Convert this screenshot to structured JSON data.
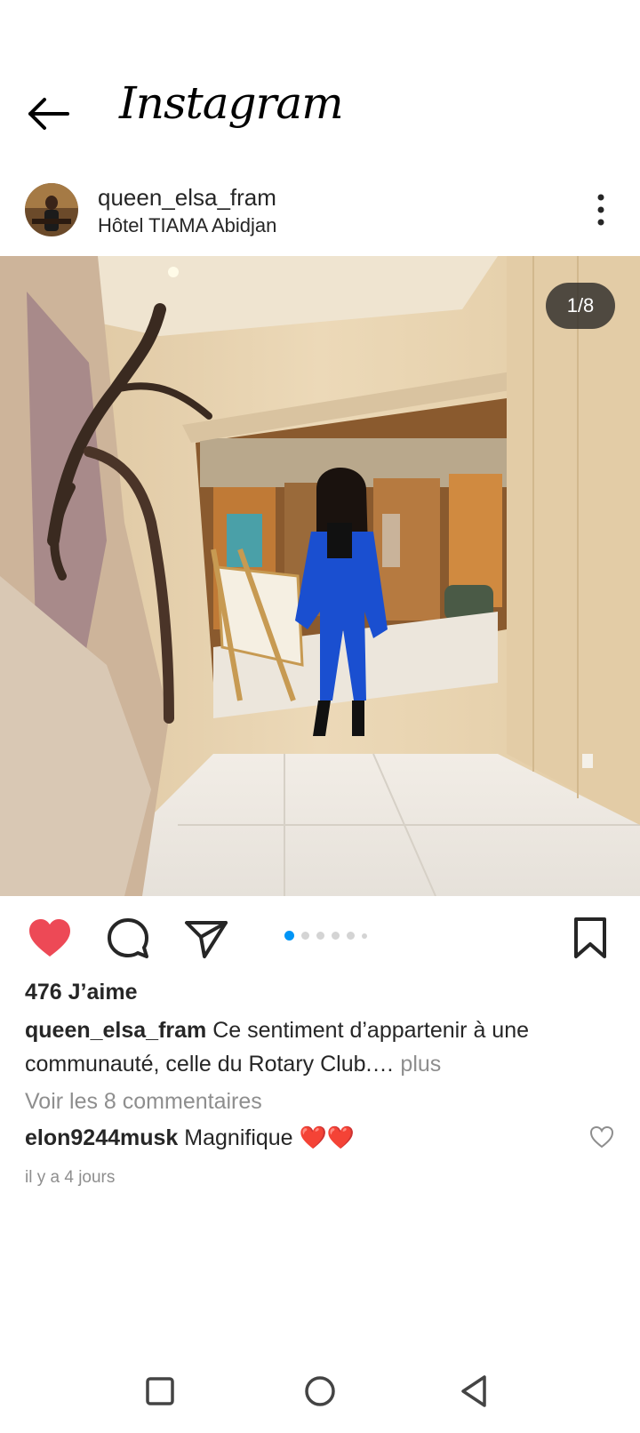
{
  "app": {
    "title": "Instagram"
  },
  "post": {
    "username": "queen_elsa_fram",
    "location": "Hôtel TIAMA Abidjan",
    "media_counter": "1/8",
    "carousel": {
      "total_dots": 6,
      "active_index": 0
    },
    "liked": true,
    "likes_text": "476 J’aime",
    "caption": {
      "username": "queen_elsa_fram",
      "text": "Ce sentiment d’appartenir à une communauté, celle du Rotary Club.…",
      "more_label": "plus"
    },
    "view_comments": "Voir les 8 commentaires",
    "top_comment": {
      "username": "elon9244musk",
      "text": "Magnifique ❤️❤️"
    },
    "timestamp": "il y a 4 jours"
  },
  "colors": {
    "like_red": "#ed4956",
    "accent_blue": "#0095f6",
    "muted": "#8e8e8e",
    "suit_blue": "#1a4fd0"
  },
  "icons": {
    "back": "arrow-left-icon",
    "more": "more-vertical-icon",
    "like": "heart-filled-icon",
    "comment": "comment-icon",
    "share": "paper-plane-icon",
    "save": "bookmark-icon",
    "nav_recent": "square-icon",
    "nav_home": "circle-icon",
    "nav_back": "triangle-back-icon"
  }
}
